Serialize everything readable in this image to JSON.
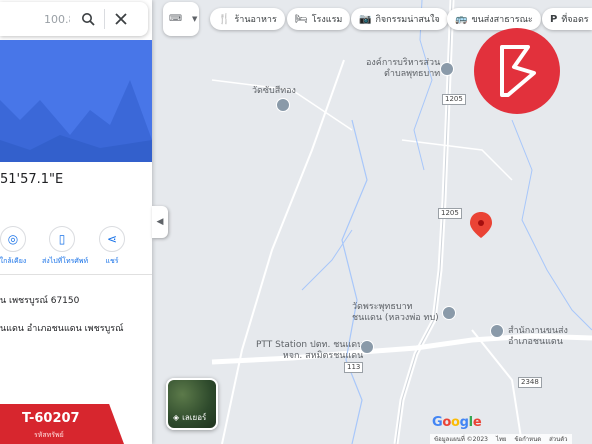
{
  "search": {
    "value": "100.8"
  },
  "panel": {
    "coordinates": "51'57.1\"E",
    "actions": [
      {
        "label": "ใกล้เคียง",
        "icon": "nearby-icon"
      },
      {
        "label": "ส่งไปที่โทรศัพท์",
        "icon": "send-to-phone-icon"
      },
      {
        "label": "แชร์",
        "icon": "share-icon"
      }
    ],
    "address_lines": [
      "น เพชรบูรณ์ 67150",
      "นแดน อำเภอชนแดน เพชรบูรณ์"
    ]
  },
  "promo": {
    "code": "T-60207",
    "sub": "รหัสทรัพย์"
  },
  "chips": [
    {
      "label": "ร้านอาหาร",
      "icon": "restaurant-icon"
    },
    {
      "label": "โรงแรม",
      "icon": "hotel-icon"
    },
    {
      "label": "กิจกรรมน่าสนใจ",
      "icon": "camera-icon"
    },
    {
      "label": "ขนส่งสาธารณะ",
      "icon": "transit-icon"
    },
    {
      "label": "ที่จอดร",
      "icon": "parking-icon"
    }
  ],
  "map": {
    "labels": {
      "obt": "องค์การบริหารส่วน\nตำบลพุทธบาท",
      "temple1": "วัดซับสีทอง",
      "temple2": "วัดพระพุทธบาท\nชนแดน (หลวงพ่อ ทบ)",
      "ptt": "PTT Station ปตท. ชนแดน\nหจก. สหมิตรชนแดน",
      "office": "สำนักงานขนส่ง\nอำเภอชนแดน"
    },
    "roads": [
      "1205",
      "1205",
      "113",
      "2348"
    ]
  },
  "layers": {
    "label": "เลเยอร์"
  },
  "google": "Google",
  "footer": [
    "ข้อมูลแผนที่ ©2023",
    "ไทย",
    "ข้อกำหนด",
    "ส่วนตัว"
  ],
  "colors": {
    "promo": "#d7262e",
    "logo": "#e2313c",
    "pin": "#ea4335",
    "hero": "#4876e8"
  }
}
